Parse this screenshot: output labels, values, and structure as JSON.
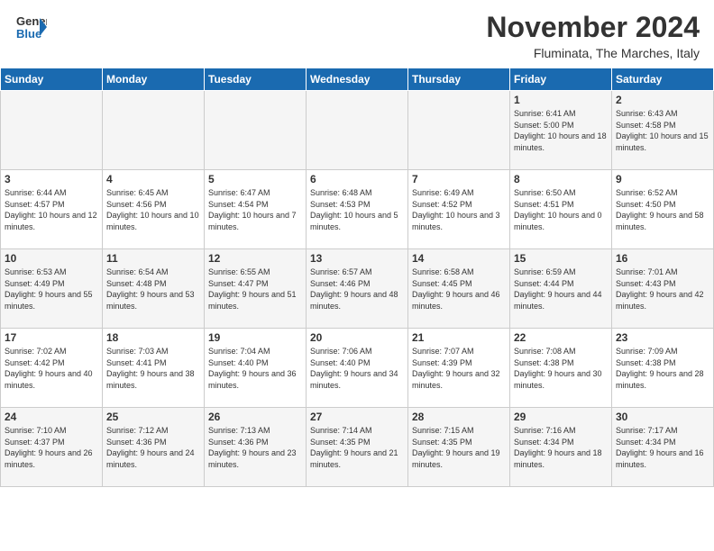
{
  "header": {
    "logo_general": "General",
    "logo_blue": "Blue",
    "month_year": "November 2024",
    "location": "Fluminata, The Marches, Italy"
  },
  "weekdays": [
    "Sunday",
    "Monday",
    "Tuesday",
    "Wednesday",
    "Thursday",
    "Friday",
    "Saturday"
  ],
  "weeks": [
    [
      {
        "day": "",
        "info": ""
      },
      {
        "day": "",
        "info": ""
      },
      {
        "day": "",
        "info": ""
      },
      {
        "day": "",
        "info": ""
      },
      {
        "day": "",
        "info": ""
      },
      {
        "day": "1",
        "info": "Sunrise: 6:41 AM\nSunset: 5:00 PM\nDaylight: 10 hours and 18 minutes."
      },
      {
        "day": "2",
        "info": "Sunrise: 6:43 AM\nSunset: 4:58 PM\nDaylight: 10 hours and 15 minutes."
      }
    ],
    [
      {
        "day": "3",
        "info": "Sunrise: 6:44 AM\nSunset: 4:57 PM\nDaylight: 10 hours and 12 minutes."
      },
      {
        "day": "4",
        "info": "Sunrise: 6:45 AM\nSunset: 4:56 PM\nDaylight: 10 hours and 10 minutes."
      },
      {
        "day": "5",
        "info": "Sunrise: 6:47 AM\nSunset: 4:54 PM\nDaylight: 10 hours and 7 minutes."
      },
      {
        "day": "6",
        "info": "Sunrise: 6:48 AM\nSunset: 4:53 PM\nDaylight: 10 hours and 5 minutes."
      },
      {
        "day": "7",
        "info": "Sunrise: 6:49 AM\nSunset: 4:52 PM\nDaylight: 10 hours and 3 minutes."
      },
      {
        "day": "8",
        "info": "Sunrise: 6:50 AM\nSunset: 4:51 PM\nDaylight: 10 hours and 0 minutes."
      },
      {
        "day": "9",
        "info": "Sunrise: 6:52 AM\nSunset: 4:50 PM\nDaylight: 9 hours and 58 minutes."
      }
    ],
    [
      {
        "day": "10",
        "info": "Sunrise: 6:53 AM\nSunset: 4:49 PM\nDaylight: 9 hours and 55 minutes."
      },
      {
        "day": "11",
        "info": "Sunrise: 6:54 AM\nSunset: 4:48 PM\nDaylight: 9 hours and 53 minutes."
      },
      {
        "day": "12",
        "info": "Sunrise: 6:55 AM\nSunset: 4:47 PM\nDaylight: 9 hours and 51 minutes."
      },
      {
        "day": "13",
        "info": "Sunrise: 6:57 AM\nSunset: 4:46 PM\nDaylight: 9 hours and 48 minutes."
      },
      {
        "day": "14",
        "info": "Sunrise: 6:58 AM\nSunset: 4:45 PM\nDaylight: 9 hours and 46 minutes."
      },
      {
        "day": "15",
        "info": "Sunrise: 6:59 AM\nSunset: 4:44 PM\nDaylight: 9 hours and 44 minutes."
      },
      {
        "day": "16",
        "info": "Sunrise: 7:01 AM\nSunset: 4:43 PM\nDaylight: 9 hours and 42 minutes."
      }
    ],
    [
      {
        "day": "17",
        "info": "Sunrise: 7:02 AM\nSunset: 4:42 PM\nDaylight: 9 hours and 40 minutes."
      },
      {
        "day": "18",
        "info": "Sunrise: 7:03 AM\nSunset: 4:41 PM\nDaylight: 9 hours and 38 minutes."
      },
      {
        "day": "19",
        "info": "Sunrise: 7:04 AM\nSunset: 4:40 PM\nDaylight: 9 hours and 36 minutes."
      },
      {
        "day": "20",
        "info": "Sunrise: 7:06 AM\nSunset: 4:40 PM\nDaylight: 9 hours and 34 minutes."
      },
      {
        "day": "21",
        "info": "Sunrise: 7:07 AM\nSunset: 4:39 PM\nDaylight: 9 hours and 32 minutes."
      },
      {
        "day": "22",
        "info": "Sunrise: 7:08 AM\nSunset: 4:38 PM\nDaylight: 9 hours and 30 minutes."
      },
      {
        "day": "23",
        "info": "Sunrise: 7:09 AM\nSunset: 4:38 PM\nDaylight: 9 hours and 28 minutes."
      }
    ],
    [
      {
        "day": "24",
        "info": "Sunrise: 7:10 AM\nSunset: 4:37 PM\nDaylight: 9 hours and 26 minutes."
      },
      {
        "day": "25",
        "info": "Sunrise: 7:12 AM\nSunset: 4:36 PM\nDaylight: 9 hours and 24 minutes."
      },
      {
        "day": "26",
        "info": "Sunrise: 7:13 AM\nSunset: 4:36 PM\nDaylight: 9 hours and 23 minutes."
      },
      {
        "day": "27",
        "info": "Sunrise: 7:14 AM\nSunset: 4:35 PM\nDaylight: 9 hours and 21 minutes."
      },
      {
        "day": "28",
        "info": "Sunrise: 7:15 AM\nSunset: 4:35 PM\nDaylight: 9 hours and 19 minutes."
      },
      {
        "day": "29",
        "info": "Sunrise: 7:16 AM\nSunset: 4:34 PM\nDaylight: 9 hours and 18 minutes."
      },
      {
        "day": "30",
        "info": "Sunrise: 7:17 AM\nSunset: 4:34 PM\nDaylight: 9 hours and 16 minutes."
      }
    ]
  ]
}
